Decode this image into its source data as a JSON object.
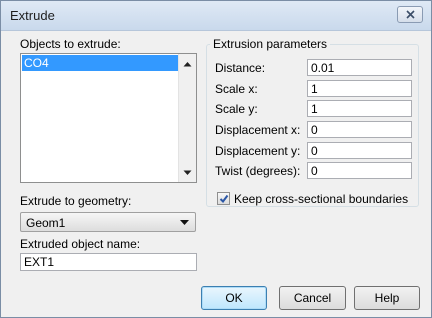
{
  "window": {
    "title": "Extrude"
  },
  "objects": {
    "label": "Objects to extrude:",
    "items": [
      "CO4"
    ]
  },
  "geometry": {
    "label": "Extrude to geometry:",
    "selected": "Geom1"
  },
  "name": {
    "label": "Extruded object name:",
    "value": "EXT1"
  },
  "params": {
    "title": "Extrusion parameters",
    "distance_label": "Distance:",
    "distance_value": "0.01",
    "scale_x_label": "Scale x:",
    "scale_x_value": "1",
    "scale_y_label": "Scale y:",
    "scale_y_value": "1",
    "disp_x_label": "Displacement x:",
    "disp_x_value": "0",
    "disp_y_label": "Displacement y:",
    "disp_y_value": "0",
    "twist_label": "Twist (degrees):",
    "twist_value": "0",
    "keep_boundaries_label": "Keep cross-sectional boundaries",
    "keep_boundaries_checked": true
  },
  "buttons": {
    "ok": "OK",
    "cancel": "Cancel",
    "help": "Help"
  },
  "icons": {
    "close": "close-icon",
    "checkmark": "check-icon",
    "dropdown": "chevron-down-icon"
  },
  "colors": {
    "selection": "#3399ff",
    "checkmark": "#2b57a6"
  }
}
